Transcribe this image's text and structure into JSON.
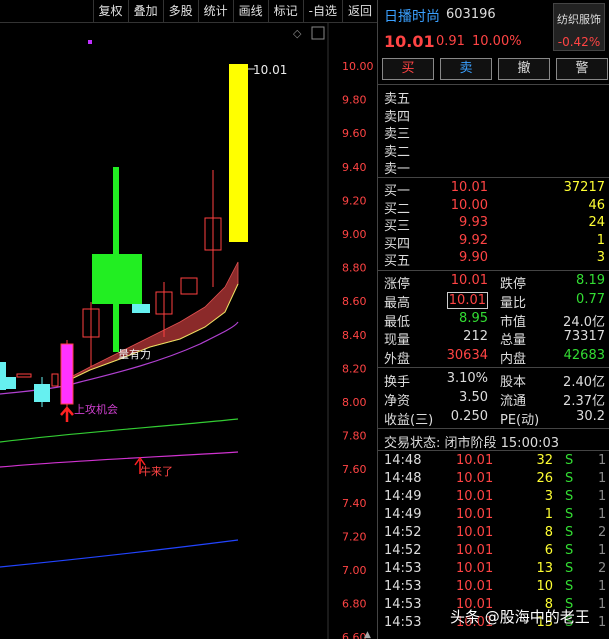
{
  "toolbar": [
    "复权",
    "叠加",
    "多股",
    "统计",
    "画线",
    "标记",
    "-自选",
    "返回"
  ],
  "chart": {
    "price_labels": [
      "10.00",
      "9.80",
      "9.60",
      "9.40",
      "9.20",
      "9.00",
      "8.80",
      "8.60",
      "8.40",
      "8.20",
      "8.00",
      "7.80",
      "7.60",
      "7.40",
      "7.20",
      "7.00",
      "6.80",
      "6.60"
    ],
    "high_label": "10.01",
    "ann_power": "量有力",
    "ann_chance": "上攻机会",
    "ann_cow": "牛来了",
    "diamond": "◇",
    "scroll_up": "▲"
  },
  "header": {
    "name": "日播时尚",
    "code": "603196",
    "price": "10.01",
    "change": "0.91",
    "pct": "10.00%"
  },
  "sector": {
    "name": "纺织服饰",
    "change": "-0.42%"
  },
  "buttons": [
    "买",
    "卖",
    "撤",
    "警"
  ],
  "sell_levels": [
    "卖五",
    "卖四",
    "卖三",
    "卖二",
    "卖一"
  ],
  "buy_levels": [
    {
      "label": "买一",
      "price": "10.01",
      "vol": "37217"
    },
    {
      "label": "买二",
      "price": "10.00",
      "vol": "46"
    },
    {
      "label": "买三",
      "price": "9.93",
      "vol": "24"
    },
    {
      "label": "买四",
      "price": "9.92",
      "vol": "1"
    },
    {
      "label": "买五",
      "price": "9.90",
      "vol": "3"
    }
  ],
  "stats": [
    {
      "k1": "涨停",
      "v1": "10.01",
      "k2": "跌停",
      "v2": "8.19"
    },
    {
      "k1": "最高",
      "v1": "10.01",
      "k2": "量比",
      "v2": "0.77"
    },
    {
      "k1": "最低",
      "v1": "8.95",
      "k2": "市值",
      "v2": "24.0亿"
    },
    {
      "k1": "现量",
      "v1": "212",
      "k2": "总量",
      "v2": "73317"
    },
    {
      "k1": "外盘",
      "v1": "30634",
      "k2": "内盘",
      "v2": "42683"
    }
  ],
  "stats2": [
    {
      "k1": "换手",
      "v1": "3.10%",
      "k2": "股本",
      "v2": "2.40亿"
    },
    {
      "k1": "净资",
      "v1": "3.50",
      "k2": "流通",
      "v2": "2.37亿"
    },
    {
      "k1": "收益(三)",
      "v1": "0.250",
      "k2": "PE(动)",
      "v2": "30.2"
    }
  ],
  "trade_status": "交易状态: 闭市阶段 15:00:03",
  "ticks": [
    {
      "t": "14:48",
      "p": "10.01",
      "v": "32",
      "s": "S",
      "n": "1"
    },
    {
      "t": "14:48",
      "p": "10.01",
      "v": "26",
      "s": "S",
      "n": "1"
    },
    {
      "t": "14:49",
      "p": "10.01",
      "v": "3",
      "s": "S",
      "n": "1"
    },
    {
      "t": "14:49",
      "p": "10.01",
      "v": "1",
      "s": "S",
      "n": "1"
    },
    {
      "t": "14:52",
      "p": "10.01",
      "v": "8",
      "s": "S",
      "n": "2"
    },
    {
      "t": "14:52",
      "p": "10.01",
      "v": "6",
      "s": "S",
      "n": "1"
    },
    {
      "t": "14:53",
      "p": "10.01",
      "v": "13",
      "s": "S",
      "n": "2"
    },
    {
      "t": "14:53",
      "p": "10.01",
      "v": "10",
      "s": "S",
      "n": "1"
    },
    {
      "t": "14:53",
      "p": "10.01",
      "v": "8",
      "s": "S",
      "n": "1"
    },
    {
      "t": "14:53",
      "p": "10.01",
      "v": "13",
      "s": "S",
      "n": "1"
    }
  ],
  "watermark": "头条 @股海中的老王"
}
